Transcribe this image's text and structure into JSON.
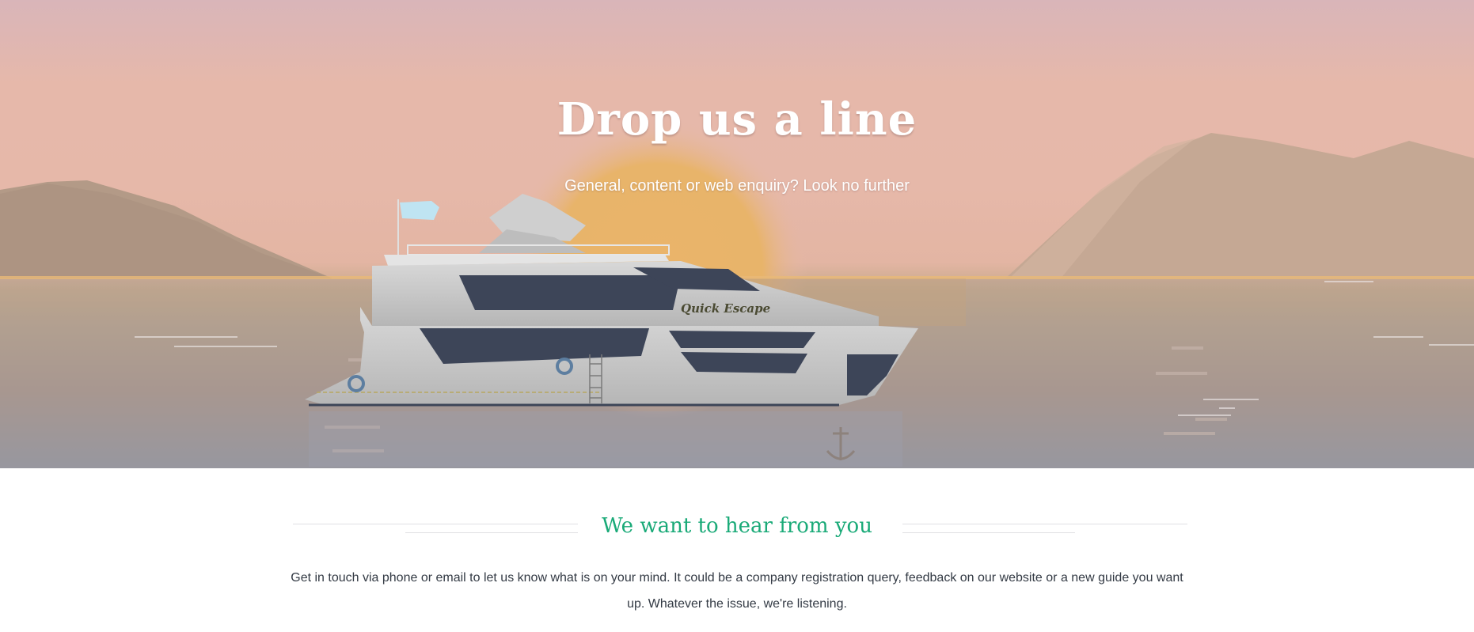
{
  "hero": {
    "title": "Drop us a line",
    "subtitle": "General, content or web enquiry? Look no further",
    "boat_name": "Quick Escape",
    "illustration": "sunset-yacht-scene"
  },
  "intro": {
    "heading": "We want to hear from you",
    "body": "Get in touch via phone or email to let us know what is on your mind. It could be a company registration query, feedback on our website or a new guide you want up. Whatever the issue, we're listening."
  },
  "colors": {
    "accent": "#1aaa78",
    "text": "#333a44",
    "sun": "#e8b46a",
    "sky": "#e6b8aa"
  }
}
